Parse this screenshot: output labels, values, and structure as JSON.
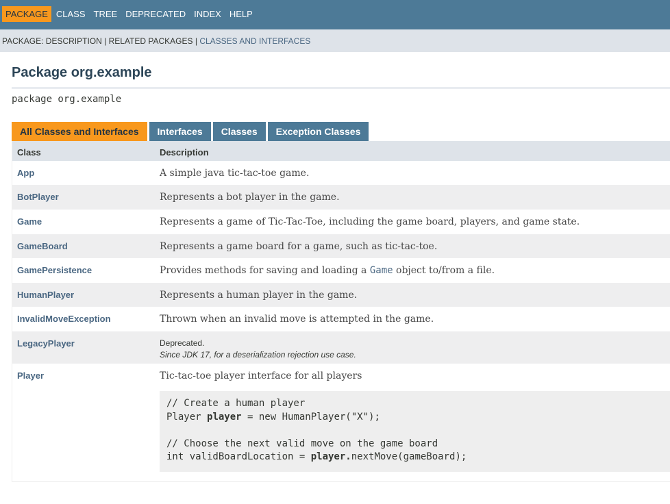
{
  "topnav": {
    "items": [
      "PACKAGE",
      "CLASS",
      "TREE",
      "DEPRECATED",
      "INDEX",
      "HELP"
    ],
    "active": "PACKAGE"
  },
  "subnav": {
    "text": "PACKAGE: DESCRIPTION | RELATED PACKAGES |",
    "link": "CLASSES AND INTERFACES"
  },
  "page": {
    "title": "Package org.example",
    "declaration": "package org.example"
  },
  "tabs": [
    "All Classes and Interfaces",
    "Interfaces",
    "Classes",
    "Exception Classes"
  ],
  "table": {
    "headers": [
      "Class",
      "Description"
    ],
    "rows": [
      {
        "name": "App",
        "description": "A simple java tic-tac-toe game."
      },
      {
        "name": "BotPlayer",
        "description": "Represents a bot player in the game."
      },
      {
        "name": "Game",
        "description": "Represents a game of Tic-Tac-Toe, including the game board, players, and game state."
      },
      {
        "name": "GameBoard",
        "description": "Represents a game board for a game, such as tic-tac-toe."
      },
      {
        "name": "GamePersistence",
        "description_before": "Provides methods for saving and loading a",
        "description_code": "Game",
        "description_after": "object to/from a file."
      },
      {
        "name": "HumanPlayer",
        "description": "Represents a human player in the game."
      },
      {
        "name": "InvalidMoveException",
        "description": "Thrown when an invalid move is attempted in the game."
      },
      {
        "name": "LegacyPlayer",
        "deprecated_label": "Deprecated.",
        "deprecated_note": "Since JDK 17, for a deserialization rejection use case."
      },
      {
        "name": "Player",
        "description": "Tic-tac-toe player interface for all players"
      }
    ],
    "code_example": {
      "line1": "// Create a human player",
      "line2_pre": "Player ",
      "line2_bold": "player",
      "line2_post": " = new HumanPlayer(\"X\");",
      "line3": "// Choose the next valid move on the game board",
      "line4_pre": "int validBoardLocation = ",
      "line4_bold": "player.",
      "line4_post": "nextMove(gameBoard);"
    }
  }
}
